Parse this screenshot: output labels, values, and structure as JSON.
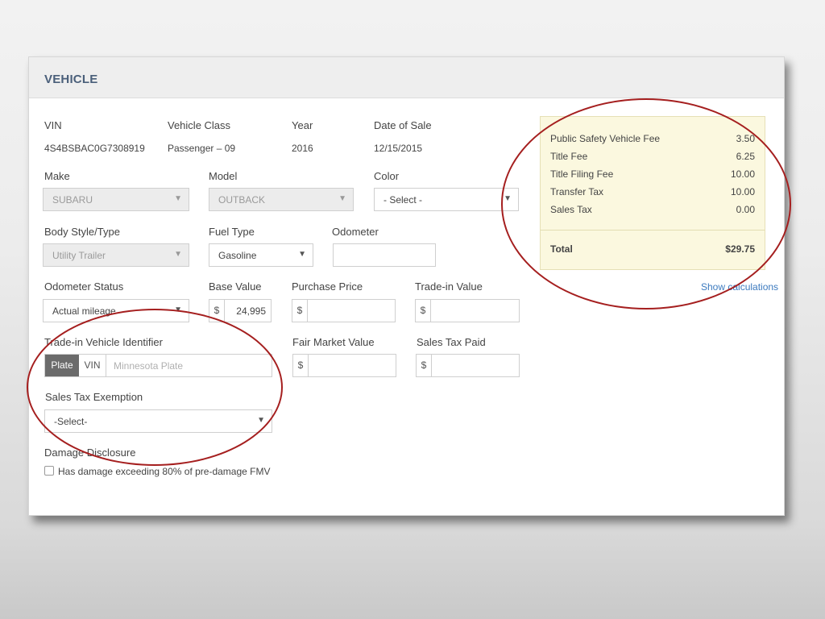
{
  "section": {
    "title": "VEHICLE"
  },
  "labels": {
    "vin": "VIN",
    "vehicle_class": "Vehicle Class",
    "year": "Year",
    "date_of_sale": "Date of Sale",
    "make": "Make",
    "model": "Model",
    "color": "Color",
    "body_style": "Body Style/Type",
    "fuel_type": "Fuel Type",
    "odometer": "Odometer",
    "odometer_status": "Odometer Status",
    "base_value": "Base Value",
    "purchase_price": "Purchase Price",
    "trade_in_value": "Trade-in Value",
    "trade_in_identifier": "Trade-in Vehicle Identifier",
    "fair_market_value": "Fair Market Value",
    "sales_tax_paid": "Sales Tax Paid",
    "sales_tax_exemption": "Sales Tax Exemption",
    "damage_disclosure": "Damage Disclosure"
  },
  "values": {
    "vin": "4S4BSBAC0G7308919",
    "vehicle_class": "Passenger – 09",
    "year": "2016",
    "date_of_sale": "12/15/2015",
    "make": "SUBARU",
    "model": "OUTBACK",
    "color": "- Select -",
    "body_style": "Utility Trailer",
    "fuel_type": "Gasoline",
    "odometer": "",
    "odometer_status": "Actual mileage",
    "base_value": "24,995",
    "purchase_price": "",
    "trade_in_value": "",
    "fair_market_value": "",
    "sales_tax_paid": "",
    "sales_tax_exemption": "-Select-"
  },
  "currency_symbol": "$",
  "trade_in_id": {
    "tabs": [
      "Plate",
      "VIN"
    ],
    "active_tab": "Plate",
    "placeholder": "Minnesota Plate"
  },
  "damage": {
    "checkbox_label": "Has damage exceeding 80% of pre-damage FMV",
    "checked": false
  },
  "fees": {
    "items": [
      {
        "label": "Public Safety Vehicle Fee",
        "amount": "3.50"
      },
      {
        "label": "Title Fee",
        "amount": "6.25"
      },
      {
        "label": "Title Filing Fee",
        "amount": "10.00"
      },
      {
        "label": "Transfer Tax",
        "amount": "10.00"
      },
      {
        "label": "Sales Tax",
        "amount": "0.00"
      }
    ],
    "total_label": "Total",
    "total_amount": "$29.75"
  },
  "show_calculations": "Show calculations",
  "colors": {
    "accent": "#3d7bbf",
    "header_title": "#4a5f7a",
    "fees_bg": "#fbf8df",
    "annotation_ring": "#a51f1f",
    "active_tab": "#6b6b6b"
  }
}
